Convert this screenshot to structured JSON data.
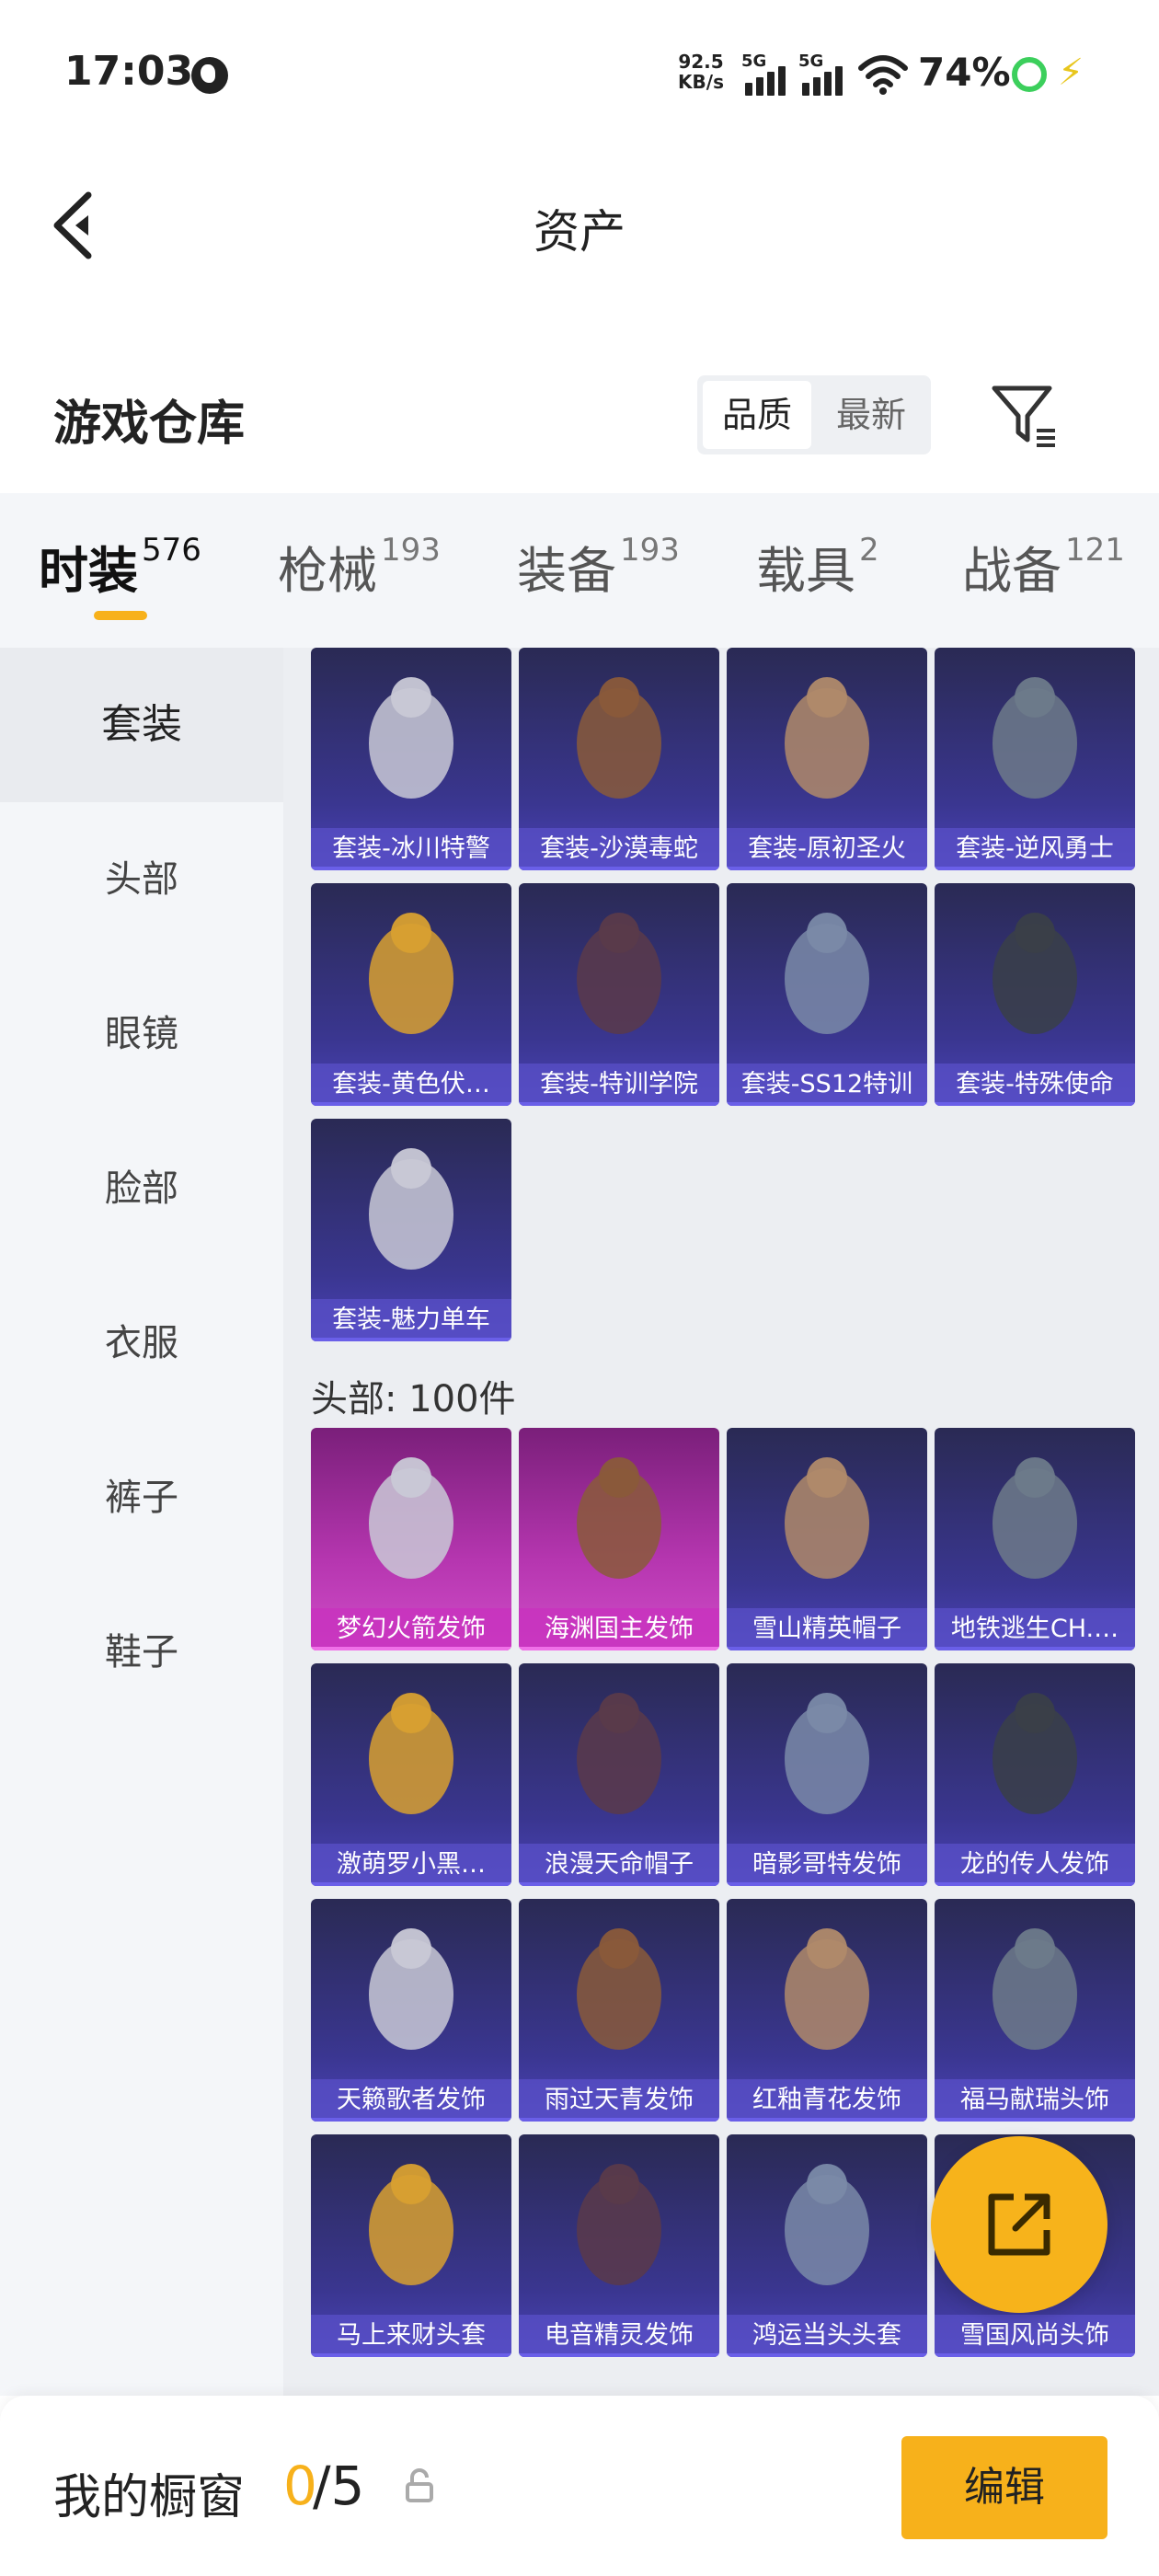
{
  "status_bar": {
    "time": "17:03",
    "net_speed_value": "92.5",
    "net_speed_unit": "KB/s",
    "signal_1": "5G",
    "signal_2": "5G",
    "battery": "74%"
  },
  "header": {
    "title": "资产"
  },
  "warehouse": {
    "title": "游戏仓库",
    "sort_options": [
      "品质",
      "最新"
    ],
    "active_sort": "品质"
  },
  "tabs": [
    {
      "label": "时装",
      "count": "576",
      "active": true
    },
    {
      "label": "枪械",
      "count": "193"
    },
    {
      "label": "装备",
      "count": "193"
    },
    {
      "label": "载具",
      "count": "2"
    },
    {
      "label": "战备",
      "count": "121"
    }
  ],
  "sidebar": {
    "items": [
      {
        "label": "套装",
        "active": true
      },
      {
        "label": "头部"
      },
      {
        "label": "眼镜"
      },
      {
        "label": "脸部"
      },
      {
        "label": "衣服"
      },
      {
        "label": "裤子"
      },
      {
        "label": "鞋子"
      }
    ]
  },
  "suits": {
    "items": [
      "套装-冰川特警",
      "套装-沙漠毒蛇",
      "套装-原初圣火",
      "套装-逆风勇士",
      "套装-黄色伏…",
      "套装-特训学院",
      "套装-SS12特训",
      "套装-特殊使命",
      "套装-魅力单车"
    ]
  },
  "head": {
    "title": "头部: 100件",
    "items": [
      {
        "name": "梦幻火箭发饰",
        "rarity": "pink"
      },
      {
        "name": "海渊国主发饰",
        "rarity": "pink"
      },
      {
        "name": "雪山精英帽子",
        "rarity": "purple"
      },
      {
        "name": "地铁逃生CH.…",
        "rarity": "purple"
      },
      {
        "name": "激萌罗小黑…",
        "rarity": "purple"
      },
      {
        "name": "浪漫天命帽子",
        "rarity": "purple"
      },
      {
        "name": "暗影哥特发饰",
        "rarity": "purple"
      },
      {
        "name": "龙的传人发饰",
        "rarity": "purple"
      },
      {
        "name": "天籁歌者发饰",
        "rarity": "purple"
      },
      {
        "name": "雨过天青发饰",
        "rarity": "purple"
      },
      {
        "name": "红釉青花发饰",
        "rarity": "purple"
      },
      {
        "name": "福马献瑞头饰",
        "rarity": "purple"
      },
      {
        "name": "马上来财头套",
        "rarity": "purple"
      },
      {
        "name": "电音精灵发饰",
        "rarity": "purple"
      },
      {
        "name": "鸿运当头头套",
        "rarity": "purple"
      },
      {
        "name": "雪国风尚头饰",
        "rarity": "purple"
      }
    ]
  },
  "showcase": {
    "label": "我的橱窗",
    "used": "0",
    "total": "/5",
    "edit_label": "编辑"
  },
  "colors": {
    "accent": "#f7b11b",
    "card_purple": "#3a3690",
    "card_pink": "#b636b0"
  }
}
